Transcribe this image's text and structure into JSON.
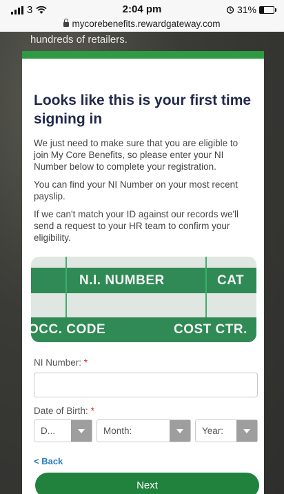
{
  "status_bar": {
    "carrier": "3",
    "time": "2:04 pm",
    "battery": "31%",
    "battery_level": 0.31,
    "url": "mycorebenefits.rewardgateway.com"
  },
  "background": {
    "text": "hundreds of retailers."
  },
  "card": {
    "accent_color": "#2e9a44",
    "title": "Looks like this is your first time signing in",
    "paragraphs": [
      "We just need to make sure that you are eligible to join My Core Benefits, so please enter your NI Number below to complete your registration.",
      "You can find your NI Number on your most recent payslip.",
      "If we can't match your ID against our records we'll send a request to your HR team to confirm your eligibility."
    ],
    "ni_card_image": {
      "top_left": "N.I. NUMBER",
      "top_right": "CAT",
      "bottom_left": "OCC. CODE",
      "bottom_right": "COST CTR."
    },
    "ni_field": {
      "label": "NI Number:",
      "required_mark": "*",
      "value": ""
    },
    "dob": {
      "label": "Date of Birth:",
      "required_mark": "*",
      "day": "D...",
      "month": "Month:",
      "year": "Year:"
    },
    "back_label": "< Back",
    "next_label": "Next",
    "next_color": "#20823c"
  }
}
